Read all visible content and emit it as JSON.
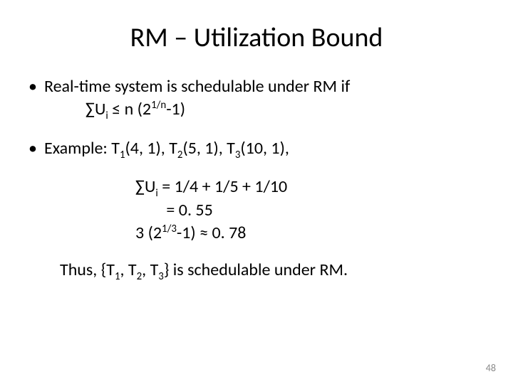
{
  "title": "RM – Utilization Bound",
  "bullet1": {
    "dot": "•",
    "line1": "Real-time system is schedulable under RM if",
    "line2_pre": "∑U",
    "line2_sub": "i",
    "line2_mid": " ≤ n (2",
    "line2_sup": "1/n",
    "line2_end": "-1)"
  },
  "bullet2": {
    "dot": "•",
    "pre": "Example: T",
    "s1": "1",
    "p1": "(4, 1), T",
    "s2": "2",
    "p2": "(5, 1), T",
    "s3": "3",
    "p3": "(10, 1),"
  },
  "calc": {
    "l1_pre": "∑U",
    "l1_sub": "i",
    "l1_post": " = 1/4 + 1/5 + 1/10",
    "l2": "        = 0. 55",
    "l3_pre": "3 (2",
    "l3_sup": "1/3",
    "l3_post": "-1) ≈ 0. 78"
  },
  "conclusion": {
    "pre": "Thus, {T",
    "s1": "1",
    "p1": ", T",
    "s2": "2",
    "p2": ", T",
    "s3": "3",
    "p3": "} is schedulable under RM."
  },
  "pagenum": "48",
  "chart_data": {
    "type": "table",
    "tasks": [
      {
        "name": "T1",
        "period": 4,
        "exec": 1
      },
      {
        "name": "T2",
        "period": 5,
        "exec": 1
      },
      {
        "name": "T3",
        "period": 10,
        "exec": 1
      }
    ],
    "sum_utilization": 0.55,
    "bound_n": 3,
    "bound_value": 0.78,
    "condition": "∑Ui ≤ n(2^{1/n} − 1)",
    "schedulable": true
  }
}
